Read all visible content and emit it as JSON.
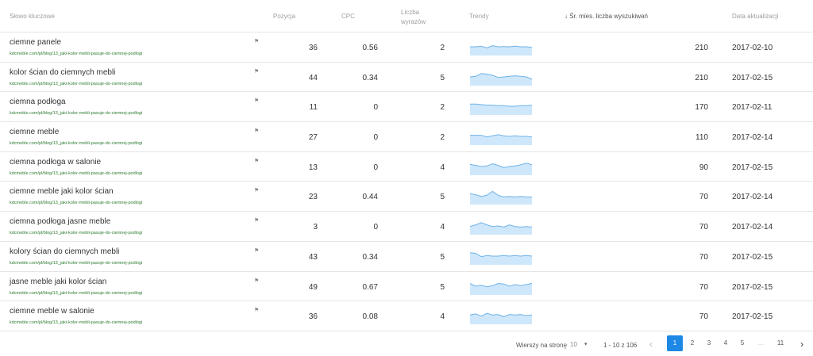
{
  "header": {
    "keyword": "Słowo kluczowe",
    "position": "Pozycja",
    "cpc": "CPC",
    "words": "Liczba wyrazów",
    "trends": "Trendy",
    "avg_sort_icon": "sort-down-arrow-icon",
    "avg": "↓ Śr. mies. liczba wyszukiwań",
    "date": "Data aktualizacji"
  },
  "rows": [
    {
      "keyword": "ciemne panele",
      "url": "kdcmeble.com/pl/blog/13_jaki-kolor-mebli-pasuje-do-ciemnej-podlogi",
      "position": "36",
      "cpc": "0.56",
      "words": "2",
      "avg": "210",
      "date": "2017-02-10",
      "trend": [
        0.5,
        0.5,
        0.45,
        0.6,
        0.4,
        0.5,
        0.48,
        0.5,
        0.45,
        0.5,
        0.5,
        0.55
      ]
    },
    {
      "keyword": "kolor ścian do ciemnych mebli",
      "url": "kdcmeble.com/pl/blog/13_jaki-kolor-mebli-pasuje-do-ciemnej-podlogi",
      "position": "44",
      "cpc": "0.34",
      "words": "5",
      "avg": "210",
      "date": "2017-02-15",
      "trend": [
        0.5,
        0.45,
        0.2,
        0.25,
        0.35,
        0.55,
        0.5,
        0.45,
        0.4,
        0.45,
        0.5,
        0.7
      ]
    },
    {
      "keyword": "ciemna podłoga",
      "url": "kdcmeble.com/pl/blog/13_jaki-kolor-mebli-pasuje-do-ciemnej-podlogi",
      "position": "11",
      "cpc": "0",
      "words": "2",
      "avg": "170",
      "date": "2017-02-11",
      "trend": [
        0.3,
        0.3,
        0.35,
        0.4,
        0.4,
        0.45,
        0.45,
        0.5,
        0.5,
        0.45,
        0.45,
        0.4
      ]
    },
    {
      "keyword": "ciemne meble",
      "url": "kdcmeble.com/pl/blog/13_jaki-kolor-mebli-pasuje-do-ciemnej-podlogi",
      "position": "27",
      "cpc": "0",
      "words": "2",
      "avg": "110",
      "date": "2017-02-14",
      "trend": [
        0.4,
        0.4,
        0.4,
        0.55,
        0.45,
        0.35,
        0.45,
        0.5,
        0.45,
        0.5,
        0.5,
        0.55
      ]
    },
    {
      "keyword": "ciemna podłoga w salonie",
      "url": "kdcmeble.com/pl/blog/13_jaki-kolor-mebli-pasuje-do-ciemnej-podlogi",
      "position": "13",
      "cpc": "0",
      "words": "4",
      "avg": "90",
      "date": "2017-02-15",
      "trend": [
        0.3,
        0.4,
        0.5,
        0.45,
        0.25,
        0.4,
        0.6,
        0.5,
        0.45,
        0.35,
        0.2,
        0.35
      ]
    },
    {
      "keyword": "ciemne meble jaki kolor ścian",
      "url": "kdcmeble.com/pl/blog/13_jaki-kolor-mebli-pasuje-do-ciemnej-podlogi",
      "position": "23",
      "cpc": "0.44",
      "words": "5",
      "avg": "70",
      "date": "2017-02-14",
      "trend": [
        0.3,
        0.4,
        0.55,
        0.45,
        0.1,
        0.45,
        0.6,
        0.55,
        0.6,
        0.55,
        0.6,
        0.6
      ]
    },
    {
      "keyword": "ciemna podłoga jasne meble",
      "url": "kdcmeble.com/pl/blog/13_jaki-kolor-mebli-pasuje-do-ciemnej-podlogi",
      "position": "3",
      "cpc": "0",
      "words": "4",
      "avg": "70",
      "date": "2017-02-14",
      "trend": [
        0.55,
        0.4,
        0.2,
        0.4,
        0.55,
        0.5,
        0.6,
        0.4,
        0.55,
        0.6,
        0.55,
        0.6
      ]
    },
    {
      "keyword": "kolory ścian do ciemnych mebli",
      "url": "kdcmeble.com/pl/blog/13_jaki-kolor-mebli-pasuje-do-ciemnej-podlogi",
      "position": "43",
      "cpc": "0.34",
      "words": "5",
      "avg": "70",
      "date": "2017-02-15",
      "trend": [
        0.2,
        0.25,
        0.55,
        0.45,
        0.5,
        0.5,
        0.45,
        0.5,
        0.45,
        0.5,
        0.45,
        0.5
      ]
    },
    {
      "keyword": "jasne meble jaki kolor ścian",
      "url": "kdcmeble.com/pl/blog/13_jaki-kolor-mebli-pasuje-do-ciemnej-podlogi",
      "position": "49",
      "cpc": "0.67",
      "words": "5",
      "avg": "70",
      "date": "2017-02-15",
      "trend": [
        0.25,
        0.5,
        0.4,
        0.55,
        0.45,
        0.25,
        0.3,
        0.5,
        0.35,
        0.45,
        0.35,
        0.25
      ]
    },
    {
      "keyword": "ciemne meble w salonie",
      "url": "kdcmeble.com/pl/blog/13_jaki-kolor-mebli-pasuje-do-ciemnej-podlogi",
      "position": "36",
      "cpc": "0.08",
      "words": "4",
      "avg": "70",
      "date": "2017-02-15",
      "trend": [
        0.45,
        0.35,
        0.55,
        0.3,
        0.45,
        0.4,
        0.6,
        0.4,
        0.45,
        0.4,
        0.5,
        0.45
      ]
    }
  ],
  "pagination": {
    "rows_per_page_label": "Wierszy na stronę",
    "rows_per_page_value": "10",
    "caret_icon": "caret-down-icon",
    "range": "1 - 10 z 106",
    "prev_icon": "chevron-left-icon",
    "next_icon": "chevron-right-icon",
    "pages": [
      "1",
      "2",
      "3",
      "4",
      "5",
      "...",
      "11"
    ],
    "active_page": "1"
  },
  "colors": {
    "accent": "#1e88e5",
    "url_green": "#2e7d32",
    "trend_fill": "#cfe7fb",
    "trend_line": "#6fb3e8"
  },
  "icons": {
    "keyword_action": "flag-icon"
  }
}
